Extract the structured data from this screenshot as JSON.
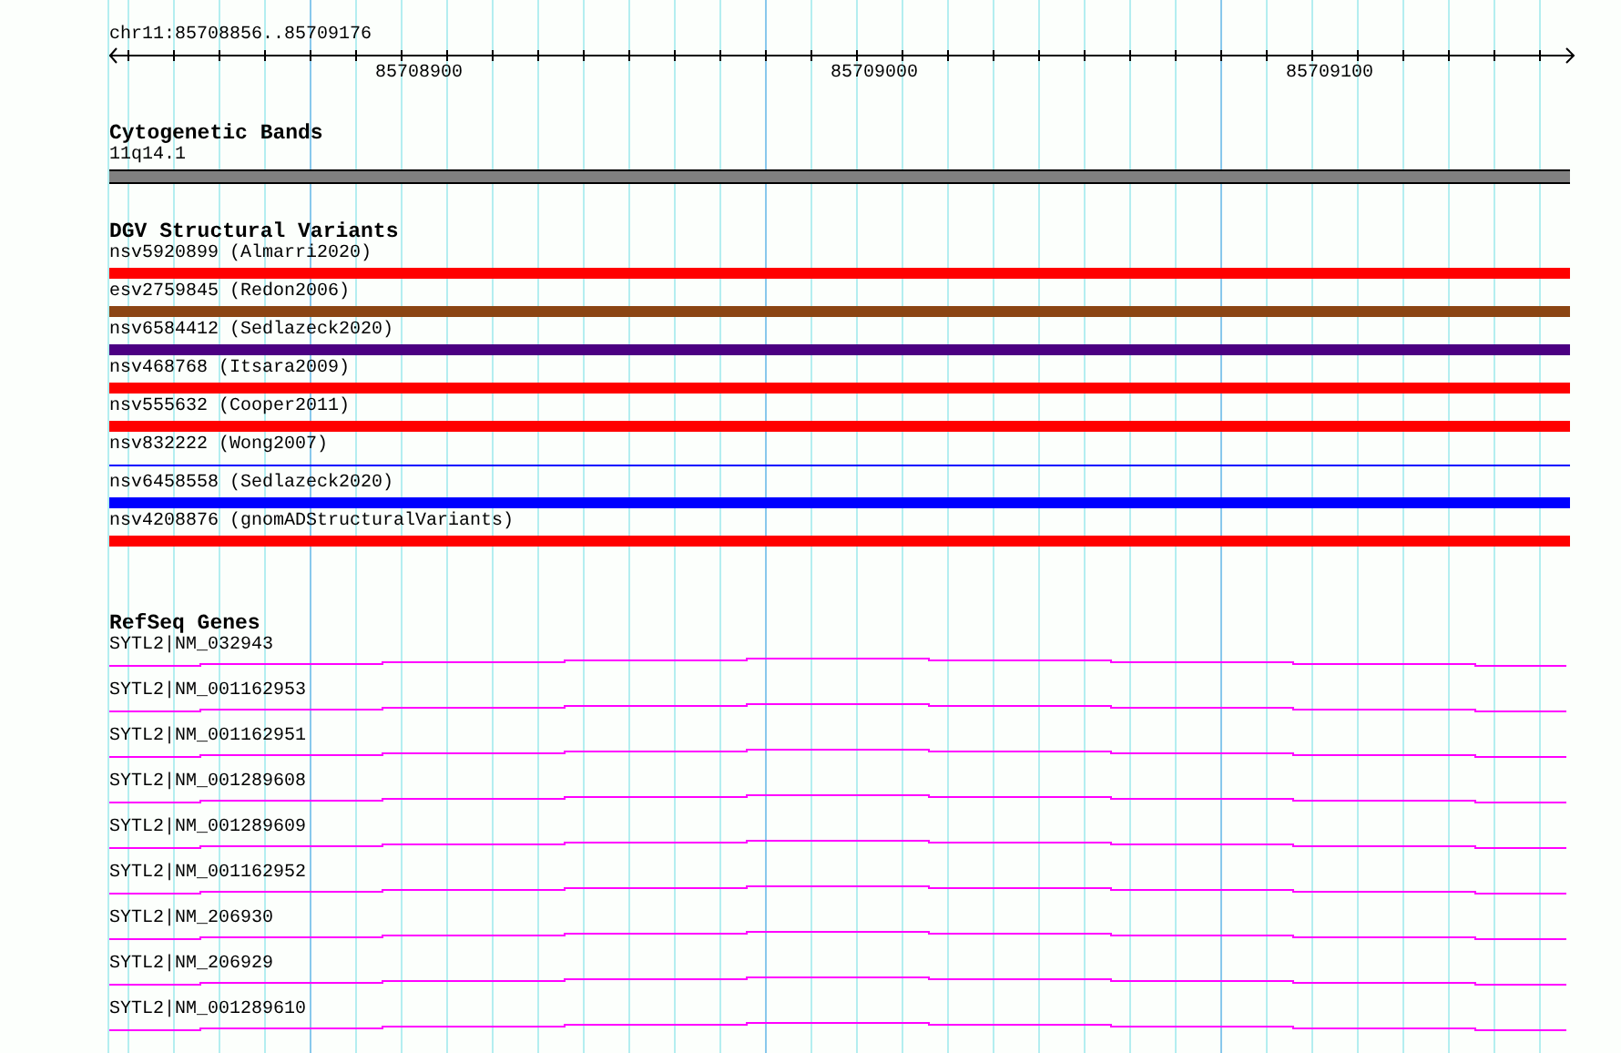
{
  "ruler": {
    "location": "chr11:85708856..85709176",
    "ticks": [
      {
        "label": "85708900"
      },
      {
        "label": "85709000"
      },
      {
        "label": "85709100"
      }
    ]
  },
  "tracks": [
    {
      "kind": "bands",
      "title": "Cytogenetic Bands",
      "features": [
        {
          "label": "11q14.1",
          "color": "#808080"
        }
      ]
    },
    {
      "kind": "variants",
      "title": "DGV Structural Variants",
      "features": [
        {
          "label": "nsv5920899 (Almarri2020)",
          "color": "#ff0000",
          "kind": "thick"
        },
        {
          "label": "esv2759845 (Redon2006)",
          "color": "#8b4513",
          "kind": "thick"
        },
        {
          "label": "nsv6584412 (Sedlazeck2020)",
          "color": "#4b0082",
          "kind": "thick"
        },
        {
          "label": "nsv468768 (Itsara2009)",
          "color": "#ff0000",
          "kind": "thick"
        },
        {
          "label": "nsv555632 (Cooper2011)",
          "color": "#ff0000",
          "kind": "thick"
        },
        {
          "label": "nsv832222 (Wong2007)",
          "color": "#0000ff",
          "kind": "thin"
        },
        {
          "label": "nsv6458558 (Sedlazeck2020)",
          "color": "#0000ff",
          "kind": "thick"
        },
        {
          "label": "nsv4208876 (gnomADStructuralVariants)",
          "color": "#ff0000",
          "kind": "thick"
        }
      ]
    },
    {
      "kind": "genes",
      "title": "RefSeq Genes",
      "features": [
        {
          "label": "SYTL2|NM_032943"
        },
        {
          "label": "SYTL2|NM_001162953"
        },
        {
          "label": "SYTL2|NM_001162951"
        },
        {
          "label": "SYTL2|NM_001289608"
        },
        {
          "label": "SYTL2|NM_001289609"
        },
        {
          "label": "SYTL2|NM_001162952"
        },
        {
          "label": "SYTL2|NM_206930"
        },
        {
          "label": "SYTL2|NM_206929"
        },
        {
          "label": "SYTL2|NM_001289610"
        }
      ]
    }
  ]
}
